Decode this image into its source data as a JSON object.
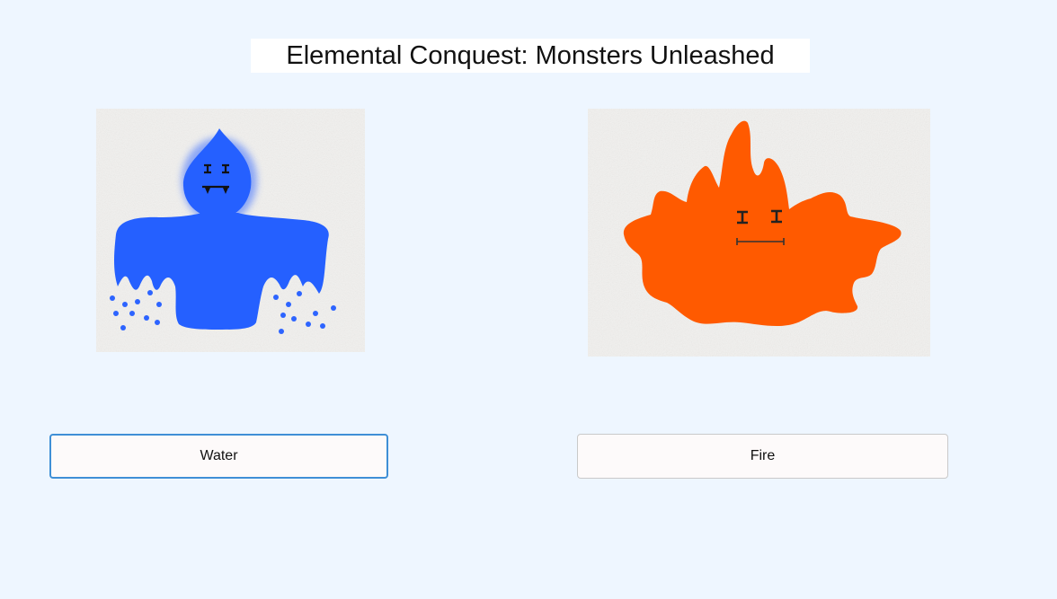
{
  "game": {
    "title": "Elemental Conquest: Monsters Unleashed"
  },
  "monsters": [
    {
      "element": "water",
      "image_icon": "water-monster-image",
      "color": "#2461ff",
      "button_label": "Water",
      "selected": true
    },
    {
      "element": "fire",
      "image_icon": "fire-monster-image",
      "color": "#ff5a00",
      "button_label": "Fire",
      "selected": false
    }
  ],
  "colors": {
    "background": "#eef6ff",
    "button_focus_border": "#3f8fd6",
    "paper": "#f1f0ee"
  }
}
